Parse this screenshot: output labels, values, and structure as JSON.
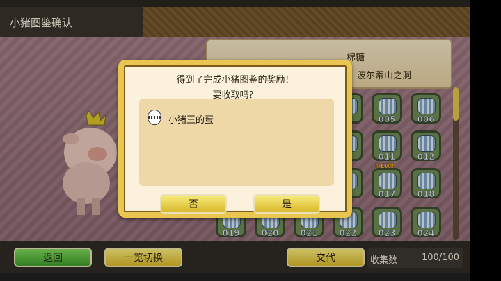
{
  "header": {
    "title": "小猪图鉴确认"
  },
  "banner": {
    "pig_name": "棉糖",
    "area": "波尔蒂山之洞"
  },
  "grid": {
    "cells": [
      {
        "num": "",
        "new": ""
      },
      {
        "num": "005",
        "new": ""
      },
      {
        "num": "006",
        "new": ""
      },
      {
        "num": "",
        "new": ""
      },
      {
        "num": "011",
        "new": ""
      },
      {
        "num": "012",
        "new": ""
      },
      {
        "num": "",
        "new": ""
      },
      {
        "num": "017",
        "new": "NEW!"
      },
      {
        "num": "018",
        "new": ""
      },
      {
        "num": "019",
        "new": ""
      },
      {
        "num": "020",
        "new": ""
      },
      {
        "num": "021",
        "new": ""
      },
      {
        "num": "022",
        "new": ""
      },
      {
        "num": "023",
        "new": ""
      },
      {
        "num": "024",
        "new": ""
      }
    ]
  },
  "bottombar": {
    "back_label": "返回",
    "switch_label": "一览切换",
    "trade_label": "交代",
    "collect_label": "收集数",
    "collect_value": "100/100"
  },
  "dialog": {
    "message_line1": "得到了完成小猪图鉴的奖励！",
    "message_line2": "要收取吗？",
    "reward_item": "小猪王的蛋",
    "no_label": "否",
    "yes_label": "是"
  },
  "colors": {
    "button_green": "#5fbd3f",
    "button_yellow": "#efd34a",
    "dialog_border": "#e8c650"
  }
}
